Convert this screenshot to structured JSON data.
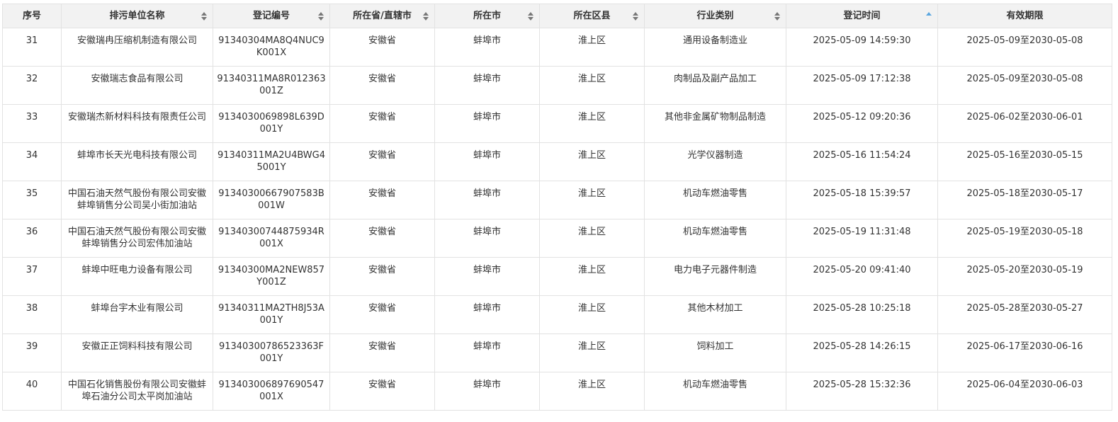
{
  "table": {
    "columns": [
      {
        "label": "序号",
        "sortable": false
      },
      {
        "label": "排污单位名称",
        "sortable": true
      },
      {
        "label": "登记编号",
        "sortable": true
      },
      {
        "label": "所在省/直辖市",
        "sortable": true
      },
      {
        "label": "所在市",
        "sortable": true
      },
      {
        "label": "所在区县",
        "sortable": true
      },
      {
        "label": "行业类别",
        "sortable": true
      },
      {
        "label": "登记时间",
        "sortable": true,
        "sorted": "asc"
      },
      {
        "label": "有效期限",
        "sortable": false
      }
    ],
    "rows": [
      [
        "31",
        "安徽瑞冉压缩机制造有限公司",
        "91340304MA8Q4NUC9K001X",
        "安徽省",
        "蚌埠市",
        "淮上区",
        "通用设备制造业",
        "2025-05-09 14:59:30",
        "2025-05-09至2030-05-08"
      ],
      [
        "32",
        "安徽瑞志食品有限公司",
        "91340311MA8R012363001Z",
        "安徽省",
        "蚌埠市",
        "淮上区",
        "肉制品及副产品加工",
        "2025-05-09 17:12:38",
        "2025-05-09至2030-05-08"
      ],
      [
        "33",
        "安徽瑞杰新材料科技有限责任公司",
        "9134030069898L639D001Y",
        "安徽省",
        "蚌埠市",
        "淮上区",
        "其他非金属矿物制品制造",
        "2025-05-12 09:20:36",
        "2025-06-02至2030-06-01"
      ],
      [
        "34",
        "蚌埠市长天光电科技有限公司",
        "91340311MA2U4BWG45001Y",
        "安徽省",
        "蚌埠市",
        "淮上区",
        "光学仪器制造",
        "2025-05-16 11:54:24",
        "2025-05-16至2030-05-15"
      ],
      [
        "35",
        "中国石油天然气股份有限公司安徽蚌埠销售分公司吴小街加油站",
        "91340300667907583B001W",
        "安徽省",
        "蚌埠市",
        "淮上区",
        "机动车燃油零售",
        "2025-05-18 15:39:57",
        "2025-05-18至2030-05-17"
      ],
      [
        "36",
        "中国石油天然气股份有限公司安徽蚌埠销售分公司宏伟加油站",
        "91340300744875934R001X",
        "安徽省",
        "蚌埠市",
        "淮上区",
        "机动车燃油零售",
        "2025-05-19 11:31:48",
        "2025-05-19至2030-05-18"
      ],
      [
        "37",
        "蚌埠中旺电力设备有限公司",
        "91340300MA2NEW857Y001Z",
        "安徽省",
        "蚌埠市",
        "淮上区",
        "电力电子元器件制造",
        "2025-05-20 09:41:40",
        "2025-05-20至2030-05-19"
      ],
      [
        "38",
        "蚌埠台宇木业有限公司",
        "91340311MA2TH8J53A001Y",
        "安徽省",
        "蚌埠市",
        "淮上区",
        "其他木材加工",
        "2025-05-28 10:25:18",
        "2025-05-28至2030-05-27"
      ],
      [
        "39",
        "安徽正正饲料科技有限公司",
        "91340300786523363F001Y",
        "安徽省",
        "蚌埠市",
        "淮上区",
        "饲料加工",
        "2025-05-28 14:26:15",
        "2025-06-17至2030-06-16"
      ],
      [
        "40",
        "中国石化销售股份有限公司安徽蚌埠石油分公司太平岗加油站",
        "913403006897690547001X",
        "安徽省",
        "蚌埠市",
        "淮上区",
        "机动车燃油零售",
        "2025-05-28 15:32:36",
        "2025-06-04至2030-06-03"
      ]
    ]
  },
  "colors": {
    "header_bg": "#f2f2f2",
    "border": "#e2e2e2",
    "sort_active": "#5ba7e0",
    "sort_inactive": "#777777"
  }
}
